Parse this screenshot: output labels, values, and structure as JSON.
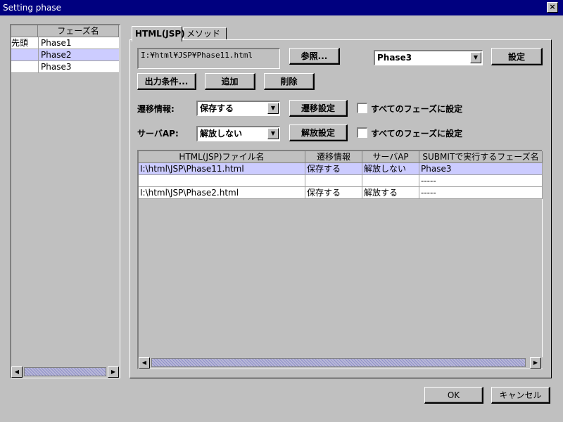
{
  "window": {
    "title": "Setting phase",
    "close_label": "×"
  },
  "phase_list": {
    "headers": [
      "",
      "フェーズ名"
    ],
    "rows": [
      {
        "marker": "先頭",
        "name": "Phase1"
      },
      {
        "marker": "",
        "name": "Phase2"
      },
      {
        "marker": "",
        "name": "Phase3"
      }
    ],
    "selected_index": 1
  },
  "tabs": [
    "HTML(JSP)",
    "メソッド"
  ],
  "active_tab": 0,
  "html_tab": {
    "file_path": "I:¥html¥JSP¥Phase11.html",
    "browse_button": "参照...",
    "phase_select": "Phase3",
    "set_button": "設定",
    "output_condition_button": "出力条件...",
    "add_button": "追加",
    "delete_button": "削除",
    "transition_label": "遷移情報:",
    "transition_select": "保存する",
    "transition_set_button": "遷移設定",
    "transition_all_label": "すべてのフェーズに設定",
    "server_label": "サーバAP:",
    "server_select": "解放しない",
    "release_set_button": "解放設定",
    "server_all_label": "すべてのフェーズに設定"
  },
  "table": {
    "headers": [
      "HTML(JSP)ファイル名",
      "遷移情報",
      "サーバAP",
      "SUBMITで実行するフェーズ名"
    ],
    "rows": [
      [
        "I:\\html\\JSP\\Phase11.html",
        "保存する",
        "解放しない",
        "Phase3"
      ],
      [
        "",
        "",
        "",
        "-----"
      ],
      [
        "I:\\html\\JSP\\Phase2.html",
        "保存する",
        "解放する",
        "-----"
      ]
    ],
    "selected_index": 0
  },
  "footer": {
    "ok_button": "OK",
    "cancel_button": "キャンセル"
  },
  "icons": {
    "left": "◀",
    "right": "▶",
    "down": "▼"
  }
}
